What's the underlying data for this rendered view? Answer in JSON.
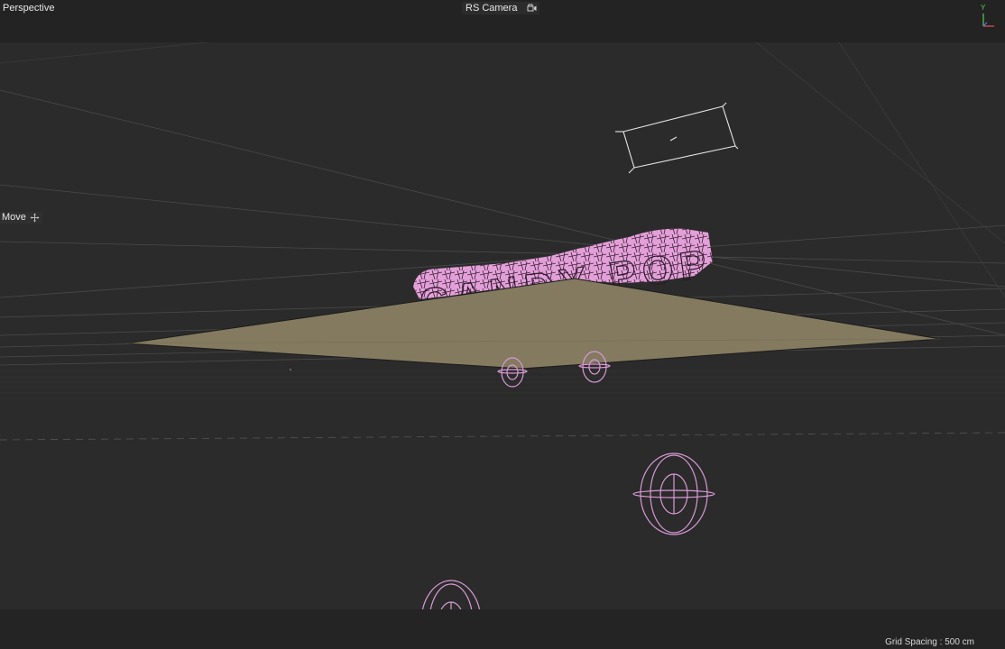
{
  "viewport": {
    "view_name": "Perspective",
    "camera_name": "RS Camera",
    "active_tool": "Move",
    "grid_spacing": "Grid Spacing : 500 cm",
    "axis": {
      "y_label": "Y",
      "y_color": "#55cc55",
      "x_color": "#e05555",
      "z_color": "#5577ee"
    }
  },
  "scene": {
    "text_object": "CANDY POP",
    "text_color": "#e3a0d8",
    "floor_color": "#837a60",
    "selection_color": "#d99ad4"
  }
}
